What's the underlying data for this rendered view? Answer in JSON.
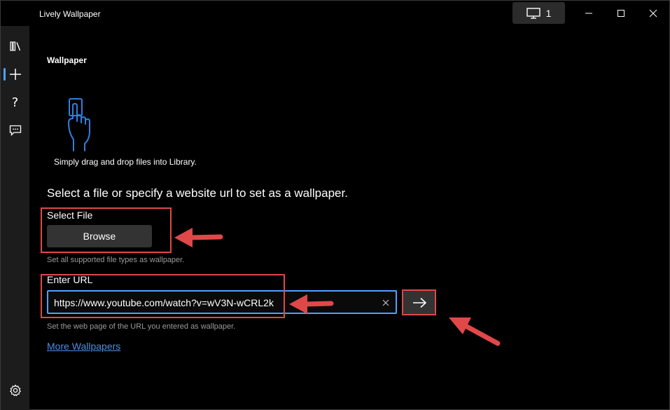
{
  "window": {
    "title": "Lively Wallpaper",
    "monitor_count": "1"
  },
  "nav": {
    "items": [
      {
        "name": "library",
        "icon": "library-icon"
      },
      {
        "name": "add-wallpaper",
        "icon": "plus-icon",
        "active": true
      },
      {
        "name": "help",
        "icon": "help-icon"
      },
      {
        "name": "feedback",
        "icon": "feedback-icon"
      },
      {
        "name": "settings",
        "icon": "gear-icon"
      }
    ]
  },
  "main": {
    "page_title": "Wallpaper",
    "drag_caption": "Simply drag and drop files into Library.",
    "heading": "Select a file or specify a website url to set as a wallpaper.",
    "select_file": {
      "label": "Select File",
      "button_label": "Browse",
      "hint": "Set all supported file types as wallpaper."
    },
    "enter_url": {
      "label": "Enter URL",
      "value": "https://www.youtube.com/watch?v=wV3N-wCRL2k",
      "hint": "Set the web page of the URL you entered as wallpaper."
    },
    "more_link": "More Wallpapers"
  },
  "colors": {
    "accent": "#4aa3ff",
    "annotation": "#e04848",
    "link": "#4a90e2"
  }
}
